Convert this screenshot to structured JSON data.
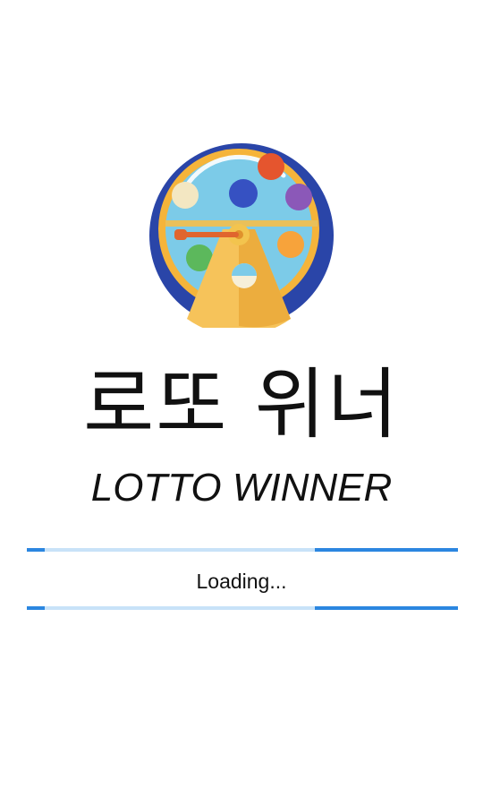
{
  "app": {
    "title_korean": "로또 위너",
    "title_english": "LOTTO WINNER"
  },
  "logo": {
    "icon": "lottery-machine-icon"
  },
  "status": {
    "loading_text": "Loading..."
  },
  "colors": {
    "accent_blue": "#2b86e0",
    "progress_track": "#c8e2f8",
    "text": "#111111",
    "background": "#ffffff"
  }
}
